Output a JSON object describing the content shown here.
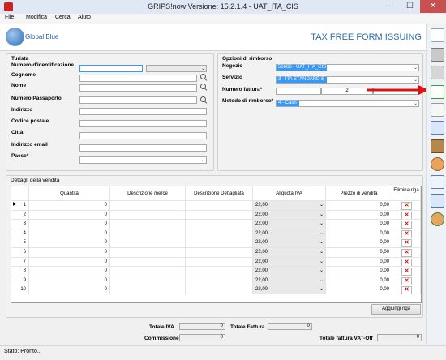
{
  "window": {
    "title": "GRIPS!now Versione: 15.2.1.4 - UAT_ITA_CIS",
    "min": "—",
    "max": "☐",
    "close": "✕"
  },
  "menu": [
    "File",
    "Modifica",
    "Cerca",
    "Aiuto"
  ],
  "header": {
    "logo_text": "Global Blue",
    "title": "TAX FREE FORM ISSUING"
  },
  "tourist": {
    "group_label": "Turista",
    "fields": [
      {
        "label": "Numero d'identificazione",
        "value": ""
      },
      {
        "label": "Cognome",
        "value": ""
      },
      {
        "label": "Nome",
        "value": ""
      },
      {
        "label": "Numero Passaporto",
        "value": ""
      },
      {
        "label": "Indirizzo",
        "value": ""
      },
      {
        "label": "Codice postale",
        "value": ""
      },
      {
        "label": "Città",
        "value": ""
      },
      {
        "label": "Indirizzo email",
        "value": ""
      },
      {
        "label": "Paese*",
        "value": ""
      }
    ]
  },
  "refund": {
    "group_label": "Opzioni di rimborso",
    "negozio_label": "Negozio",
    "negozio_value": "56666 - UAT_ITA_CIS",
    "servizio_label": "Servizio",
    "servizio_value": "3 - ITA STANDARD B",
    "fattura_label": "Numero fattura*",
    "fattura_value": "2",
    "metodo_label": "Metodo di rimborso*",
    "metodo_value": "4 - Cash"
  },
  "sales": {
    "group_label": "Dettagli della vendita",
    "columns": [
      "Quantità",
      "Descrizione merce",
      "Descrizione Dettagliata",
      "Aliquota IVA",
      "Prezzo di vendita",
      "Elimina riga"
    ],
    "rows": [
      {
        "n": "1",
        "qty": "0",
        "iva": "22,00",
        "price": "0,00"
      },
      {
        "n": "2",
        "qty": "0",
        "iva": "22,00",
        "price": "0,00"
      },
      {
        "n": "3",
        "qty": "0",
        "iva": "22,00",
        "price": "0,00"
      },
      {
        "n": "4",
        "qty": "0",
        "iva": "22,00",
        "price": "0,00"
      },
      {
        "n": "5",
        "qty": "0",
        "iva": "22,00",
        "price": "0,00"
      },
      {
        "n": "6",
        "qty": "0",
        "iva": "22,00",
        "price": "0,00"
      },
      {
        "n": "7",
        "qty": "0",
        "iva": "22,00",
        "price": "0,00"
      },
      {
        "n": "8",
        "qty": "0",
        "iva": "22,00",
        "price": "0,00"
      },
      {
        "n": "9",
        "qty": "0",
        "iva": "22,00",
        "price": "0,00"
      },
      {
        "n": "10",
        "qty": "0",
        "iva": "22,00",
        "price": "0,00"
      }
    ],
    "add_row_label": "Aggiungi riga"
  },
  "totals": {
    "iva_label": "Totale IVA",
    "iva_value": "0",
    "fattura_label": "Totale Fattura",
    "fattura_value": "0",
    "commissione_label": "Commissione",
    "commissione_value": "0",
    "vatoff_label": "Totale fattura VAT-Off",
    "vatoff_value": "0"
  },
  "status": "Stato: Pronto...",
  "toolbar_icons": [
    "new-document-icon",
    "print-icon",
    "print-preview-icon",
    "issue-form-icon",
    "document-icon",
    "copy-documents-icon",
    "database-icon",
    "user-icon",
    "search-document-icon",
    "refresh-document-icon",
    "user-remove-icon"
  ]
}
